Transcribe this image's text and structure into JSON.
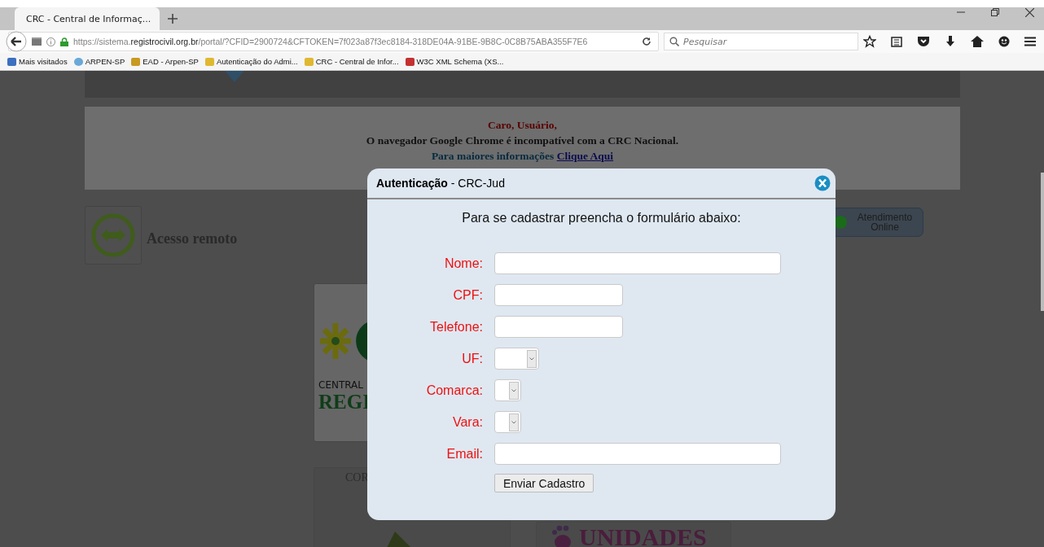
{
  "browser": {
    "tab": {
      "title": "CRC - Central de Informaç...",
      "selected": true
    },
    "url": "https://sistema.**registrocivil.org.br**/portal/?CFID=2900724&CFTOKEN=7f023a87f3ec8184-318DE04A-91BE-9B8C-0C8B75ABA355F7E6",
    "search": {
      "placeholder": "Pesquisar"
    },
    "bookmarks": [
      "Mais visitados",
      "ARPEN-SP",
      "EAD - Arpen-SP",
      "Autenticação do Admi...",
      "CRC - Central de Infor...",
      "W3C XML Schema (XS..."
    ]
  },
  "page": {
    "notice": {
      "greeting": "Caro, Usuário,",
      "message": "O navegador Google Chrome é incompatível com a CRC Nacional.",
      "info": "Para maiores informações",
      "link": "Clique Aqui"
    },
    "remote_access": "Acesso remoto",
    "chat_button": "Atendimento Online",
    "logo_card": {
      "top": "CENTRAL",
      "bottom": "REGI"
    },
    "card_2": "COR",
    "units_card": "UNIDADES"
  },
  "dialog": {
    "title": "**Autenticação** - CRC-Jud",
    "intro": "Para se cadastrar preencha o formulário abaixo:",
    "fields": [
      {
        "label": "Nome:",
        "kind": "text"
      },
      {
        "label": "CPF:",
        "kind": "text"
      },
      {
        "label": "Telefone:",
        "kind": "text"
      },
      {
        "label": "UF:",
        "kind": "select"
      },
      {
        "label": "Comarca:",
        "kind": "select"
      },
      {
        "label": "Vara:",
        "kind": "select"
      },
      {
        "label": "Email:",
        "kind": "text"
      }
    ],
    "submit": "Enviar Cadastro"
  }
}
